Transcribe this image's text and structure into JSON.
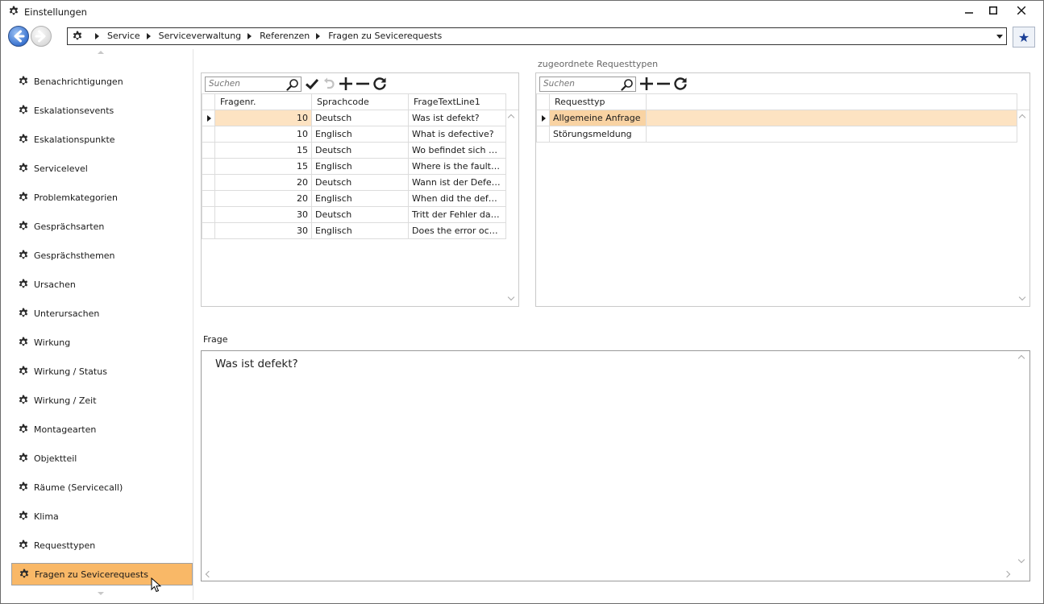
{
  "window": {
    "title": "Einstellungen",
    "icons": {
      "app": "gear-icon",
      "minimize": "minimize-icon",
      "maximize": "maximize-icon",
      "close": "close-icon"
    }
  },
  "navigation": {
    "back_icon": "back-arrow-icon",
    "forward_icon": "forward-arrow-icon",
    "breadcrumbs": [
      "Service",
      "Serviceverwaltung",
      "Referenzen",
      "Fragen zu Sevicerequests"
    ],
    "favorite_icon": "star-icon"
  },
  "sidebar": {
    "items": [
      {
        "label": "Benachrichtigungen"
      },
      {
        "label": "Eskalationsevents"
      },
      {
        "label": "Eskalationspunkte"
      },
      {
        "label": "Servicelevel"
      },
      {
        "label": "Problemkategorien"
      },
      {
        "label": "Gesprächsarten"
      },
      {
        "label": "Gesprächsthemen"
      },
      {
        "label": "Ursachen"
      },
      {
        "label": "Unterursachen"
      },
      {
        "label": "Wirkung"
      },
      {
        "label": "Wirkung / Status"
      },
      {
        "label": "Wirkung / Zeit"
      },
      {
        "label": "Montagearten"
      },
      {
        "label": "Objektteil"
      },
      {
        "label": "Räume (Servicecall)"
      },
      {
        "label": "Klima"
      },
      {
        "label": "Requesttypen"
      },
      {
        "label": "Fragen zu Sevicerequests"
      }
    ],
    "selected_index": 17
  },
  "questions": {
    "search_placeholder": "Suchen",
    "columns": [
      "Fragenr.",
      "Sprachcode",
      "FrageTextLine1"
    ],
    "rows": [
      {
        "nr": "10",
        "lang": "Deutsch",
        "text": "Was ist defekt?"
      },
      {
        "nr": "10",
        "lang": "Englisch",
        "text": "What is defective?"
      },
      {
        "nr": "15",
        "lang": "Deutsch",
        "text": "Wo befindet sich die…"
      },
      {
        "nr": "15",
        "lang": "Englisch",
        "text": "Where is the fault lo…"
      },
      {
        "nr": "20",
        "lang": "Deutsch",
        "text": "Wann ist der Defekt…"
      },
      {
        "nr": "20",
        "lang": "Englisch",
        "text": "When did the defect…"
      },
      {
        "nr": "30",
        "lang": "Deutsch",
        "text": "Tritt der Fehler dauer…"
      },
      {
        "nr": "30",
        "lang": "Englisch",
        "text": "Does the error occur…"
      }
    ],
    "selected_index": 0
  },
  "requesttypes": {
    "title": "zugeordnete Requesttypen",
    "search_placeholder": "Suchen",
    "column": "Requesttyp",
    "rows": [
      "Allgemeine Anfrage",
      "Störungsmeldung"
    ],
    "selected_index": 0
  },
  "frage": {
    "label": "Frage",
    "text": "Was ist defekt?"
  },
  "colors": {
    "selected_item": "#f9b867",
    "selected_row": "#fde3c2",
    "accent_blue": "#3b74d0"
  }
}
